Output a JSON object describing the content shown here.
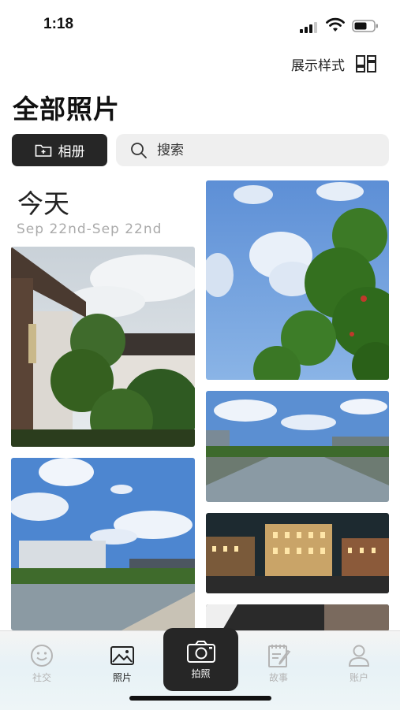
{
  "status_bar": {
    "time": "1:18"
  },
  "header": {
    "display_style_label": "展示样式",
    "title": "全部照片"
  },
  "toolbar": {
    "album_label": "相册",
    "search_placeholder": "搜索"
  },
  "section": {
    "title": "今天",
    "date_range": "Sep 22nd-Sep 22nd"
  },
  "bottom_nav": {
    "items": [
      {
        "label": "社交",
        "icon": "smiley-icon"
      },
      {
        "label": "照片",
        "icon": "image-icon"
      },
      {
        "label": "拍照",
        "icon": "camera-icon"
      },
      {
        "label": "故事",
        "icon": "notebook-icon"
      },
      {
        "label": "账户",
        "icon": "person-icon"
      }
    ],
    "active_index": 1
  },
  "colors": {
    "primary_dark": "#262626",
    "search_bg": "#efefef",
    "muted_text": "#aaaaaa"
  }
}
